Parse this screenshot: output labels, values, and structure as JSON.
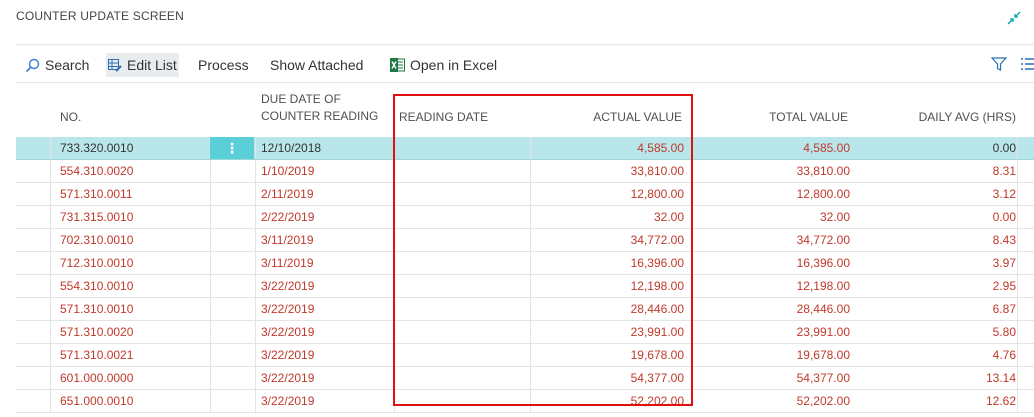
{
  "page": {
    "title": "COUNTER UPDATE SCREEN"
  },
  "toolbar": {
    "search_label": "Search",
    "edit_list_label": "Edit List",
    "process_label": "Process",
    "show_attached_label": "Show Attached",
    "open_in_excel_label": "Open in Excel"
  },
  "colors": {
    "accent": "#00a4b5",
    "selected_row": "#b9e6ea",
    "value_text": "#c0392b",
    "highlight": "#e01010"
  },
  "table": {
    "headers": {
      "no": "NO.",
      "due_line1": "DUE DATE OF",
      "due_line2": "COUNTER READING",
      "reading_date": "READING DATE",
      "actual_value": "ACTUAL VALUE",
      "total_value": "TOTAL VALUE",
      "daily_avg": "DAILY AVG (HRS)"
    },
    "rows": [
      {
        "no": "733.320.0010",
        "due": "12/10/2018",
        "reading_date": "",
        "actual": "4,585.00",
        "total": "4,585.00",
        "avg": "0.00"
      },
      {
        "no": "554.310.0020",
        "due": "1/10/2019",
        "reading_date": "",
        "actual": "33,810.00",
        "total": "33,810.00",
        "avg": "8.31"
      },
      {
        "no": "571.310.0011",
        "due": "2/11/2019",
        "reading_date": "",
        "actual": "12,800.00",
        "total": "12,800.00",
        "avg": "3.12"
      },
      {
        "no": "731.315.0010",
        "due": "2/22/2019",
        "reading_date": "",
        "actual": "32.00",
        "total": "32.00",
        "avg": "0.00"
      },
      {
        "no": "702.310.0010",
        "due": "3/11/2019",
        "reading_date": "",
        "actual": "34,772.00",
        "total": "34,772.00",
        "avg": "8.43"
      },
      {
        "no": "712.310.0010",
        "due": "3/11/2019",
        "reading_date": "",
        "actual": "16,396.00",
        "total": "16,396.00",
        "avg": "3.97"
      },
      {
        "no": "554.310.0010",
        "due": "3/22/2019",
        "reading_date": "",
        "actual": "12,198.00",
        "total": "12,198.00",
        "avg": "2.95"
      },
      {
        "no": "571.310.0010",
        "due": "3/22/2019",
        "reading_date": "",
        "actual": "28,446.00",
        "total": "28,446.00",
        "avg": "6.87"
      },
      {
        "no": "571.310.0020",
        "due": "3/22/2019",
        "reading_date": "",
        "actual": "23,991.00",
        "total": "23,991.00",
        "avg": "5.80"
      },
      {
        "no": "571.310.0021",
        "due": "3/22/2019",
        "reading_date": "",
        "actual": "19,678.00",
        "total": "19,678.00",
        "avg": "4.76"
      },
      {
        "no": "601.000.0000",
        "due": "3/22/2019",
        "reading_date": "",
        "actual": "54,377.00",
        "total": "54,377.00",
        "avg": "13.14"
      },
      {
        "no": "651.000.0010",
        "due": "3/22/2019",
        "reading_date": "",
        "actual": "52,202.00",
        "total": "52,202.00",
        "avg": "12.62"
      }
    ]
  }
}
